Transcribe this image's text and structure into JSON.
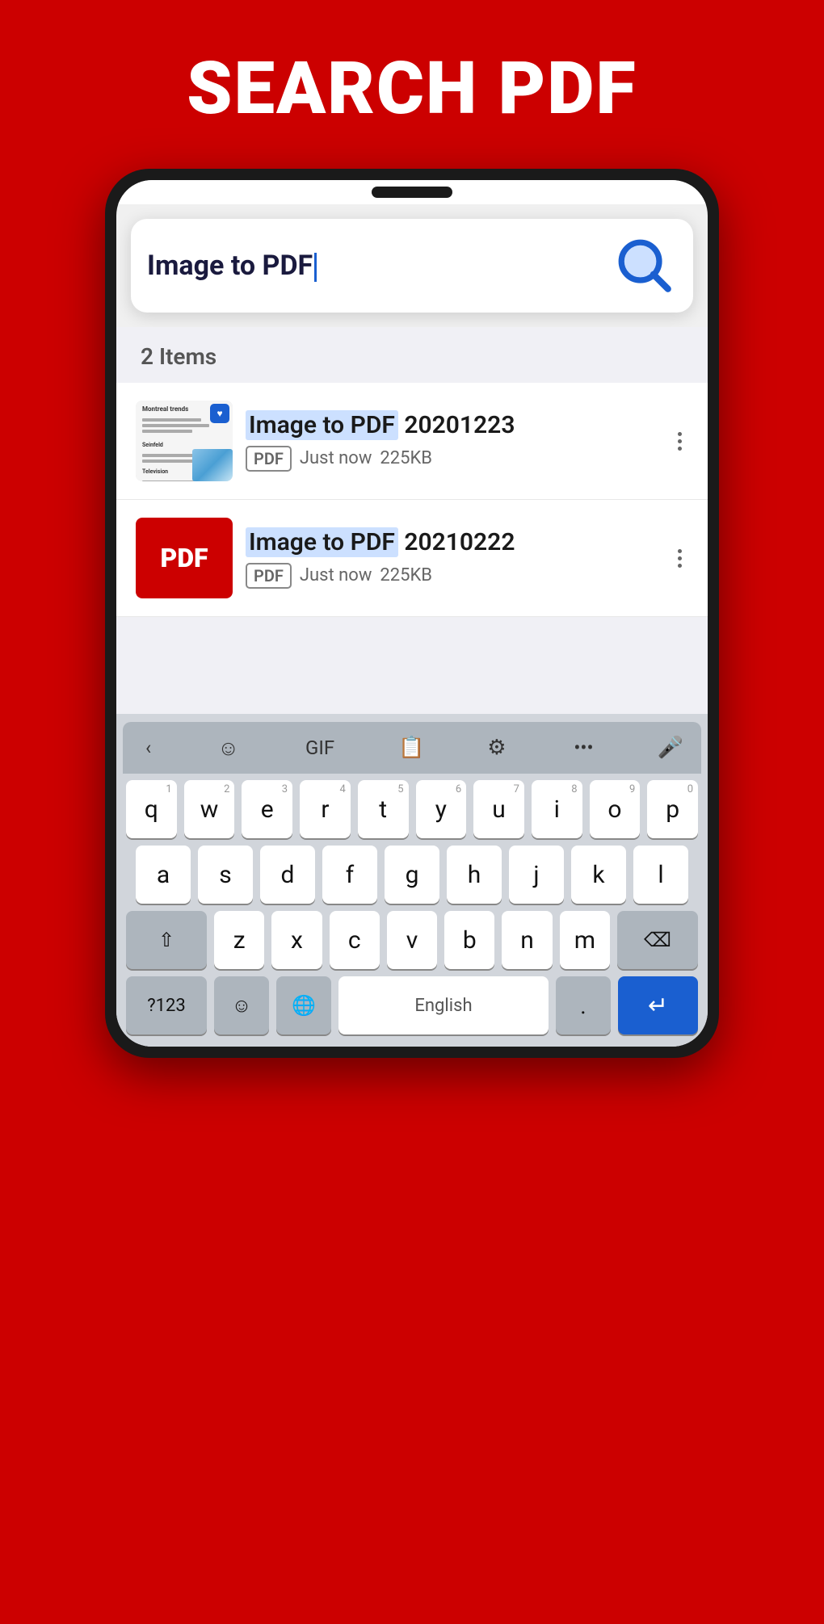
{
  "app": {
    "title": "SEARCH PDF",
    "background_color": "#cc0000"
  },
  "search": {
    "query": "Image to PDF",
    "placeholder": "Image to PDF",
    "icon": "search-icon"
  },
  "results": {
    "count_label": "2 Items",
    "items": [
      {
        "id": 1,
        "name_highlight": "Image to PDF",
        "name_rest": " 20201223",
        "badge": "PDF",
        "date": "Just now",
        "size": "225KB",
        "thumbnail_type": "screenshot"
      },
      {
        "id": 2,
        "name_highlight": "Image to PDF",
        "name_rest": " 20210222",
        "badge": "PDF",
        "date": "Just now",
        "size": "225KB",
        "thumbnail_type": "pdf"
      }
    ]
  },
  "keyboard": {
    "toolbar": {
      "back_label": "‹",
      "emoji_label": "☺",
      "gif_label": "GIF",
      "clipboard_label": "📋",
      "settings_label": "⚙",
      "more_label": "•••",
      "mic_label": "🎤"
    },
    "rows": [
      [
        "q",
        "w",
        "e",
        "r",
        "t",
        "y",
        "u",
        "i",
        "o",
        "p"
      ],
      [
        "a",
        "s",
        "d",
        "f",
        "g",
        "h",
        "j",
        "k",
        "l"
      ],
      [
        "z",
        "x",
        "c",
        "v",
        "b",
        "n",
        "m"
      ]
    ],
    "numbers": [
      "1",
      "2",
      "3",
      "4",
      "5",
      "6",
      "7",
      "8",
      "9",
      "0"
    ],
    "bottom": {
      "num_label": "?123",
      "emoji_label": "☺",
      "globe_label": "🌐",
      "space_label": "English",
      "period_label": ".",
      "enter_label": "↵"
    }
  }
}
